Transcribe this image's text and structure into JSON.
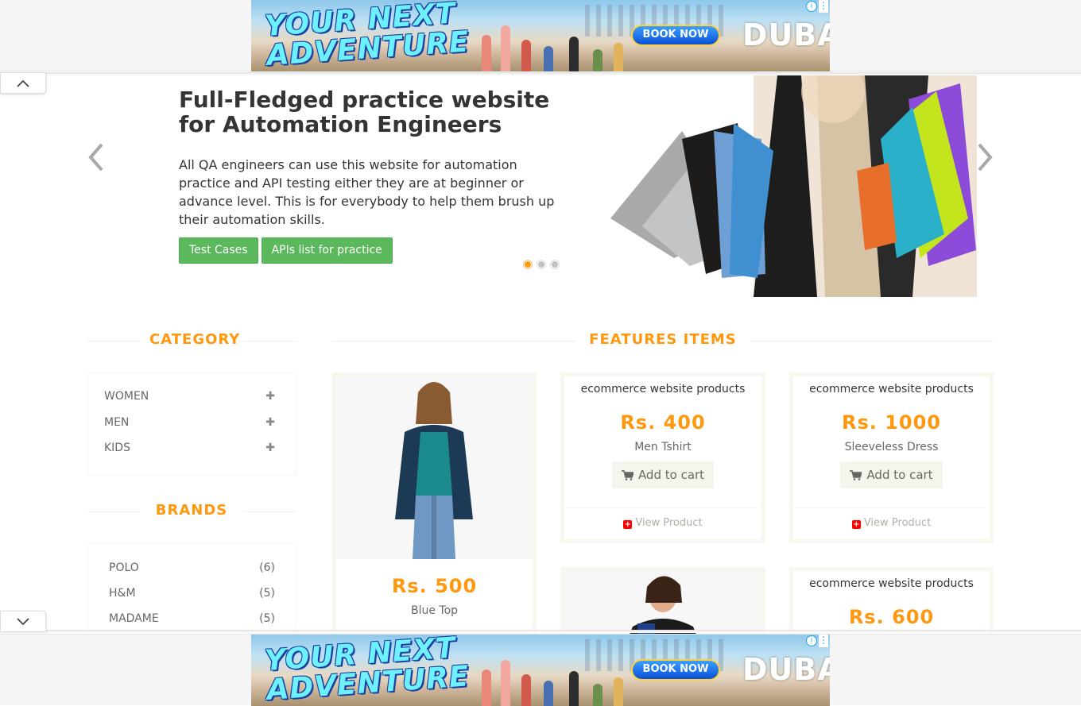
{
  "ad": {
    "headline": "YOUR NEXT ADVENTURE",
    "cta": "BOOK NOW",
    "brand": "DUBAI",
    "info_icon": "info-icon",
    "menu_icon": "kebab-menu-icon"
  },
  "slider": {
    "title": "Full-Fledged practice website for Automation Engineers",
    "description": "All QA engineers can use this website for automation practice and API testing either they are at beginner or advance level. This is for everybody to help them brush up their automation skills.",
    "buttons": [
      "Test Cases",
      "APIs list for practice"
    ],
    "prev_icon": "chevron-left-icon",
    "next_icon": "chevron-right-icon",
    "active_dot": 1,
    "dot_count": 3
  },
  "sidebar": {
    "category_title": "CATEGORY",
    "categories": [
      "WOMEN",
      "MEN",
      "KIDS"
    ],
    "brands_title": "BRANDS",
    "brands": [
      {
        "name": "POLO",
        "count": "(6)"
      },
      {
        "name": "H&M",
        "count": "(5)"
      },
      {
        "name": "MADAME",
        "count": "(5)"
      }
    ]
  },
  "features": {
    "title": "FEATURES ITEMS",
    "add_to_cart": "Add to cart",
    "view_product": "View Product",
    "products": [
      {
        "label": "",
        "price": "Rs. 500",
        "name": "Blue Top"
      },
      {
        "label": "ecommerce website products",
        "price": "Rs. 400",
        "name": "Men Tshirt"
      },
      {
        "label": "ecommerce website products",
        "price": "Rs. 1000",
        "name": "Sleeveless Dress"
      },
      {
        "label": "",
        "price": "",
        "name": ""
      },
      {
        "label": "ecommerce website products",
        "price": "Rs. 600",
        "name": ""
      }
    ]
  },
  "colors": {
    "accent": "#FE980F",
    "button_green": "#5CB85C",
    "text_dark": "#363432",
    "text_muted": "#696763"
  }
}
